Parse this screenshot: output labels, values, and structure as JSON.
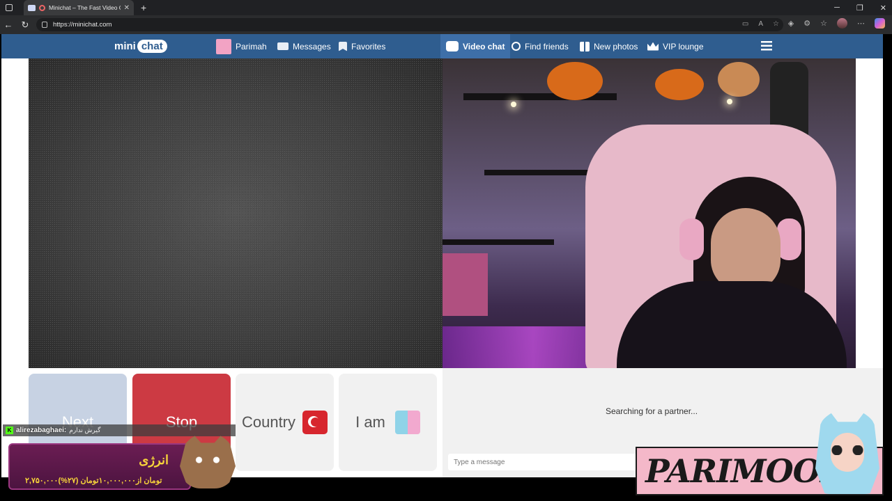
{
  "browser": {
    "tab_title": "Minichat – The Fast Video C",
    "url": "https://minichat.com"
  },
  "site": {
    "logo_mini": "mini",
    "logo_chat": "chat",
    "nav": {
      "profile": "Parimah",
      "messages": "Messages",
      "favorites": "Favorites",
      "video_chat": "Video chat",
      "find_friends": "Find friends",
      "new_photos": "New photos",
      "vip_lounge": "VIP lounge"
    },
    "controls": {
      "next": "Next",
      "stop": "Stop",
      "country": "Country",
      "i_am": "I am"
    },
    "chat": {
      "status": "Searching for a partner...",
      "placeholder": "Type a message"
    }
  },
  "overlays": {
    "donor_name": "alirezabaghaei:",
    "donor_message": "گیرش ندارم",
    "energy_title": "انرژی",
    "energy_price": "۲,۷۵۰,۰۰۰تومان از۱۰,۰۰۰,۰۰۰تومان (۲۷%)",
    "streamer_banner": "PARIMOON"
  },
  "colors": {
    "nav_bg": "#2f5d8f",
    "stop_red": "#cc3a43",
    "next_disabled": "#c7d2e3"
  }
}
